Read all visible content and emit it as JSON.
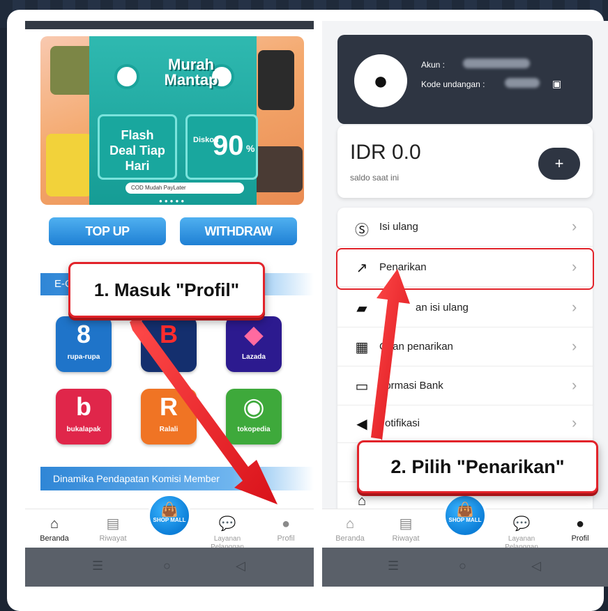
{
  "left_screen": {
    "banner": {
      "headline_1": "Murah",
      "headline_2": "Mantap",
      "flash_deal": "Flash Deal Tiap Hari",
      "discount_label": "Diskon",
      "discount_value": "90",
      "discount_unit": "%",
      "payment_strip": "COD  Mudah  PayLater"
    },
    "buttons": {
      "topup": "TOP UP",
      "withdraw": "WITHDRAW"
    },
    "section_ecom": "E-C",
    "apps": [
      {
        "name": "rupa-rupa",
        "label": "rupa-rupa",
        "glyph": "8",
        "color": "#1f74c9"
      },
      {
        "name": "blibli",
        "label": "",
        "glyph": "B",
        "color": "#142f6e"
      },
      {
        "name": "lazada",
        "label": "Lazada",
        "glyph": "◆",
        "color": "#2c1a8f"
      },
      {
        "name": "bukalapak",
        "label": "bukalapak",
        "glyph": "b",
        "color": "#e0264a"
      },
      {
        "name": "ralali",
        "label": "Ralali",
        "glyph": "R",
        "color": "#f07424"
      },
      {
        "name": "tokopedia",
        "label": "tokopedia",
        "glyph": "◉",
        "color": "#3ea93b"
      }
    ],
    "section_dinamika": "Dinamika Pendapatan Komisi Member",
    "nav": [
      {
        "label": "Beranda",
        "icon": "home-icon"
      },
      {
        "label": "Riwayat",
        "icon": "history-icon"
      },
      {
        "label": "SHOP MALL",
        "icon": "shop-bag-icon"
      },
      {
        "label": "Layanan Pelanggan",
        "icon": "chat-icon"
      },
      {
        "label": "Profil",
        "icon": "person-icon"
      }
    ]
  },
  "right_screen": {
    "account_label": "Akun :",
    "invite_label": "Kode undangan :",
    "balance": "IDR 0.0",
    "balance_caption": "saldo saat ini",
    "plus": "+",
    "menu": [
      {
        "label": "Isi ulang",
        "icon": "dollar-icon"
      },
      {
        "label": "Penarikan",
        "icon": "arrow-up-right-icon"
      },
      {
        "label": "an isi ulang",
        "icon": "cash-icon"
      },
      {
        "label": "C  tan penarikan",
        "icon": "calendar-icon"
      },
      {
        "label": "I  ormasi Bank",
        "icon": "card-icon"
      },
      {
        "label": "otifikasi",
        "icon": "speaker-icon"
      }
    ],
    "nav": [
      {
        "label": "Beranda"
      },
      {
        "label": "Riwayat"
      },
      {
        "label": "SHOP MALL"
      },
      {
        "label": "Layanan Pelanggan"
      },
      {
        "label": "Profil"
      }
    ]
  },
  "callouts": {
    "step1": "1. Masuk \"Profil\"",
    "step2": "2. Pilih \"Penarikan\""
  },
  "colors": {
    "accent_red": "#e2232a",
    "dark_header": "#2e3542",
    "blue_button": "#1f80d4"
  }
}
